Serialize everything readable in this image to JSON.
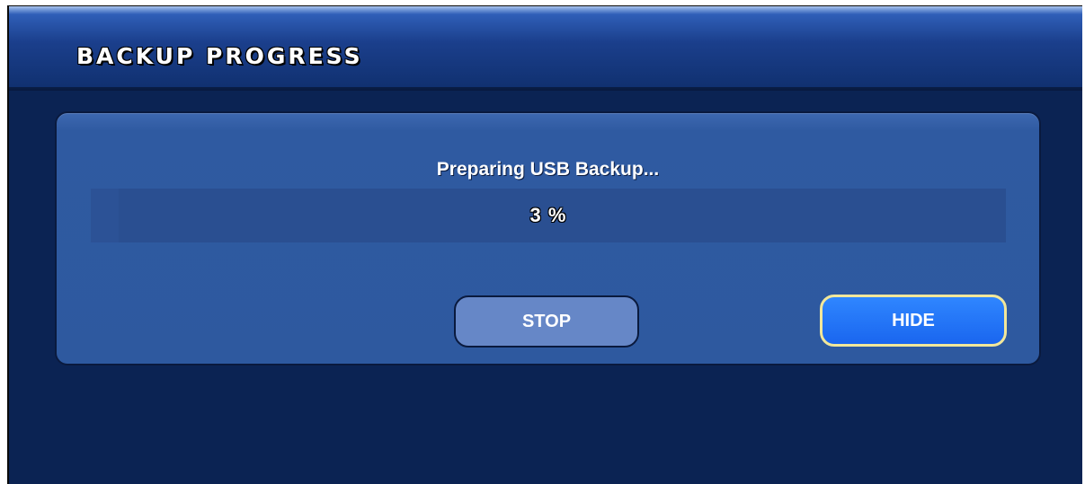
{
  "dialog": {
    "title": "BACKUP PROGRESS",
    "status_message": "Preparing USB Backup...",
    "progress": {
      "percent": 3,
      "label": "3 %"
    },
    "buttons": {
      "stop_label": "STOP",
      "hide_label": "HIDE"
    },
    "colors": {
      "background": "#0b2353",
      "panel": "#2e599f",
      "focused_button": "#1f6ff5",
      "focus_border": "#f2e79a"
    }
  }
}
